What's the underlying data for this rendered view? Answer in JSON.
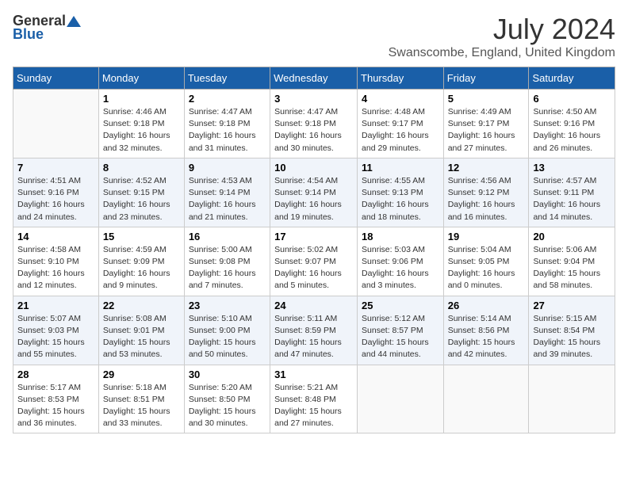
{
  "logo": {
    "general": "General",
    "blue": "Blue"
  },
  "title": "July 2024",
  "location": "Swanscombe, England, United Kingdom",
  "days_header": [
    "Sunday",
    "Monday",
    "Tuesday",
    "Wednesday",
    "Thursday",
    "Friday",
    "Saturday"
  ],
  "weeks": [
    [
      {
        "day": "",
        "info": ""
      },
      {
        "day": "1",
        "info": "Sunrise: 4:46 AM\nSunset: 9:18 PM\nDaylight: 16 hours\nand 32 minutes."
      },
      {
        "day": "2",
        "info": "Sunrise: 4:47 AM\nSunset: 9:18 PM\nDaylight: 16 hours\nand 31 minutes."
      },
      {
        "day": "3",
        "info": "Sunrise: 4:47 AM\nSunset: 9:18 PM\nDaylight: 16 hours\nand 30 minutes."
      },
      {
        "day": "4",
        "info": "Sunrise: 4:48 AM\nSunset: 9:17 PM\nDaylight: 16 hours\nand 29 minutes."
      },
      {
        "day": "5",
        "info": "Sunrise: 4:49 AM\nSunset: 9:17 PM\nDaylight: 16 hours\nand 27 minutes."
      },
      {
        "day": "6",
        "info": "Sunrise: 4:50 AM\nSunset: 9:16 PM\nDaylight: 16 hours\nand 26 minutes."
      }
    ],
    [
      {
        "day": "7",
        "info": "Sunrise: 4:51 AM\nSunset: 9:16 PM\nDaylight: 16 hours\nand 24 minutes."
      },
      {
        "day": "8",
        "info": "Sunrise: 4:52 AM\nSunset: 9:15 PM\nDaylight: 16 hours\nand 23 minutes."
      },
      {
        "day": "9",
        "info": "Sunrise: 4:53 AM\nSunset: 9:14 PM\nDaylight: 16 hours\nand 21 minutes."
      },
      {
        "day": "10",
        "info": "Sunrise: 4:54 AM\nSunset: 9:14 PM\nDaylight: 16 hours\nand 19 minutes."
      },
      {
        "day": "11",
        "info": "Sunrise: 4:55 AM\nSunset: 9:13 PM\nDaylight: 16 hours\nand 18 minutes."
      },
      {
        "day": "12",
        "info": "Sunrise: 4:56 AM\nSunset: 9:12 PM\nDaylight: 16 hours\nand 16 minutes."
      },
      {
        "day": "13",
        "info": "Sunrise: 4:57 AM\nSunset: 9:11 PM\nDaylight: 16 hours\nand 14 minutes."
      }
    ],
    [
      {
        "day": "14",
        "info": "Sunrise: 4:58 AM\nSunset: 9:10 PM\nDaylight: 16 hours\nand 12 minutes."
      },
      {
        "day": "15",
        "info": "Sunrise: 4:59 AM\nSunset: 9:09 PM\nDaylight: 16 hours\nand 9 minutes."
      },
      {
        "day": "16",
        "info": "Sunrise: 5:00 AM\nSunset: 9:08 PM\nDaylight: 16 hours\nand 7 minutes."
      },
      {
        "day": "17",
        "info": "Sunrise: 5:02 AM\nSunset: 9:07 PM\nDaylight: 16 hours\nand 5 minutes."
      },
      {
        "day": "18",
        "info": "Sunrise: 5:03 AM\nSunset: 9:06 PM\nDaylight: 16 hours\nand 3 minutes."
      },
      {
        "day": "19",
        "info": "Sunrise: 5:04 AM\nSunset: 9:05 PM\nDaylight: 16 hours\nand 0 minutes."
      },
      {
        "day": "20",
        "info": "Sunrise: 5:06 AM\nSunset: 9:04 PM\nDaylight: 15 hours\nand 58 minutes."
      }
    ],
    [
      {
        "day": "21",
        "info": "Sunrise: 5:07 AM\nSunset: 9:03 PM\nDaylight: 15 hours\nand 55 minutes."
      },
      {
        "day": "22",
        "info": "Sunrise: 5:08 AM\nSunset: 9:01 PM\nDaylight: 15 hours\nand 53 minutes."
      },
      {
        "day": "23",
        "info": "Sunrise: 5:10 AM\nSunset: 9:00 PM\nDaylight: 15 hours\nand 50 minutes."
      },
      {
        "day": "24",
        "info": "Sunrise: 5:11 AM\nSunset: 8:59 PM\nDaylight: 15 hours\nand 47 minutes."
      },
      {
        "day": "25",
        "info": "Sunrise: 5:12 AM\nSunset: 8:57 PM\nDaylight: 15 hours\nand 44 minutes."
      },
      {
        "day": "26",
        "info": "Sunrise: 5:14 AM\nSunset: 8:56 PM\nDaylight: 15 hours\nand 42 minutes."
      },
      {
        "day": "27",
        "info": "Sunrise: 5:15 AM\nSunset: 8:54 PM\nDaylight: 15 hours\nand 39 minutes."
      }
    ],
    [
      {
        "day": "28",
        "info": "Sunrise: 5:17 AM\nSunset: 8:53 PM\nDaylight: 15 hours\nand 36 minutes."
      },
      {
        "day": "29",
        "info": "Sunrise: 5:18 AM\nSunset: 8:51 PM\nDaylight: 15 hours\nand 33 minutes."
      },
      {
        "day": "30",
        "info": "Sunrise: 5:20 AM\nSunset: 8:50 PM\nDaylight: 15 hours\nand 30 minutes."
      },
      {
        "day": "31",
        "info": "Sunrise: 5:21 AM\nSunset: 8:48 PM\nDaylight: 15 hours\nand 27 minutes."
      },
      {
        "day": "",
        "info": ""
      },
      {
        "day": "",
        "info": ""
      },
      {
        "day": "",
        "info": ""
      }
    ]
  ]
}
